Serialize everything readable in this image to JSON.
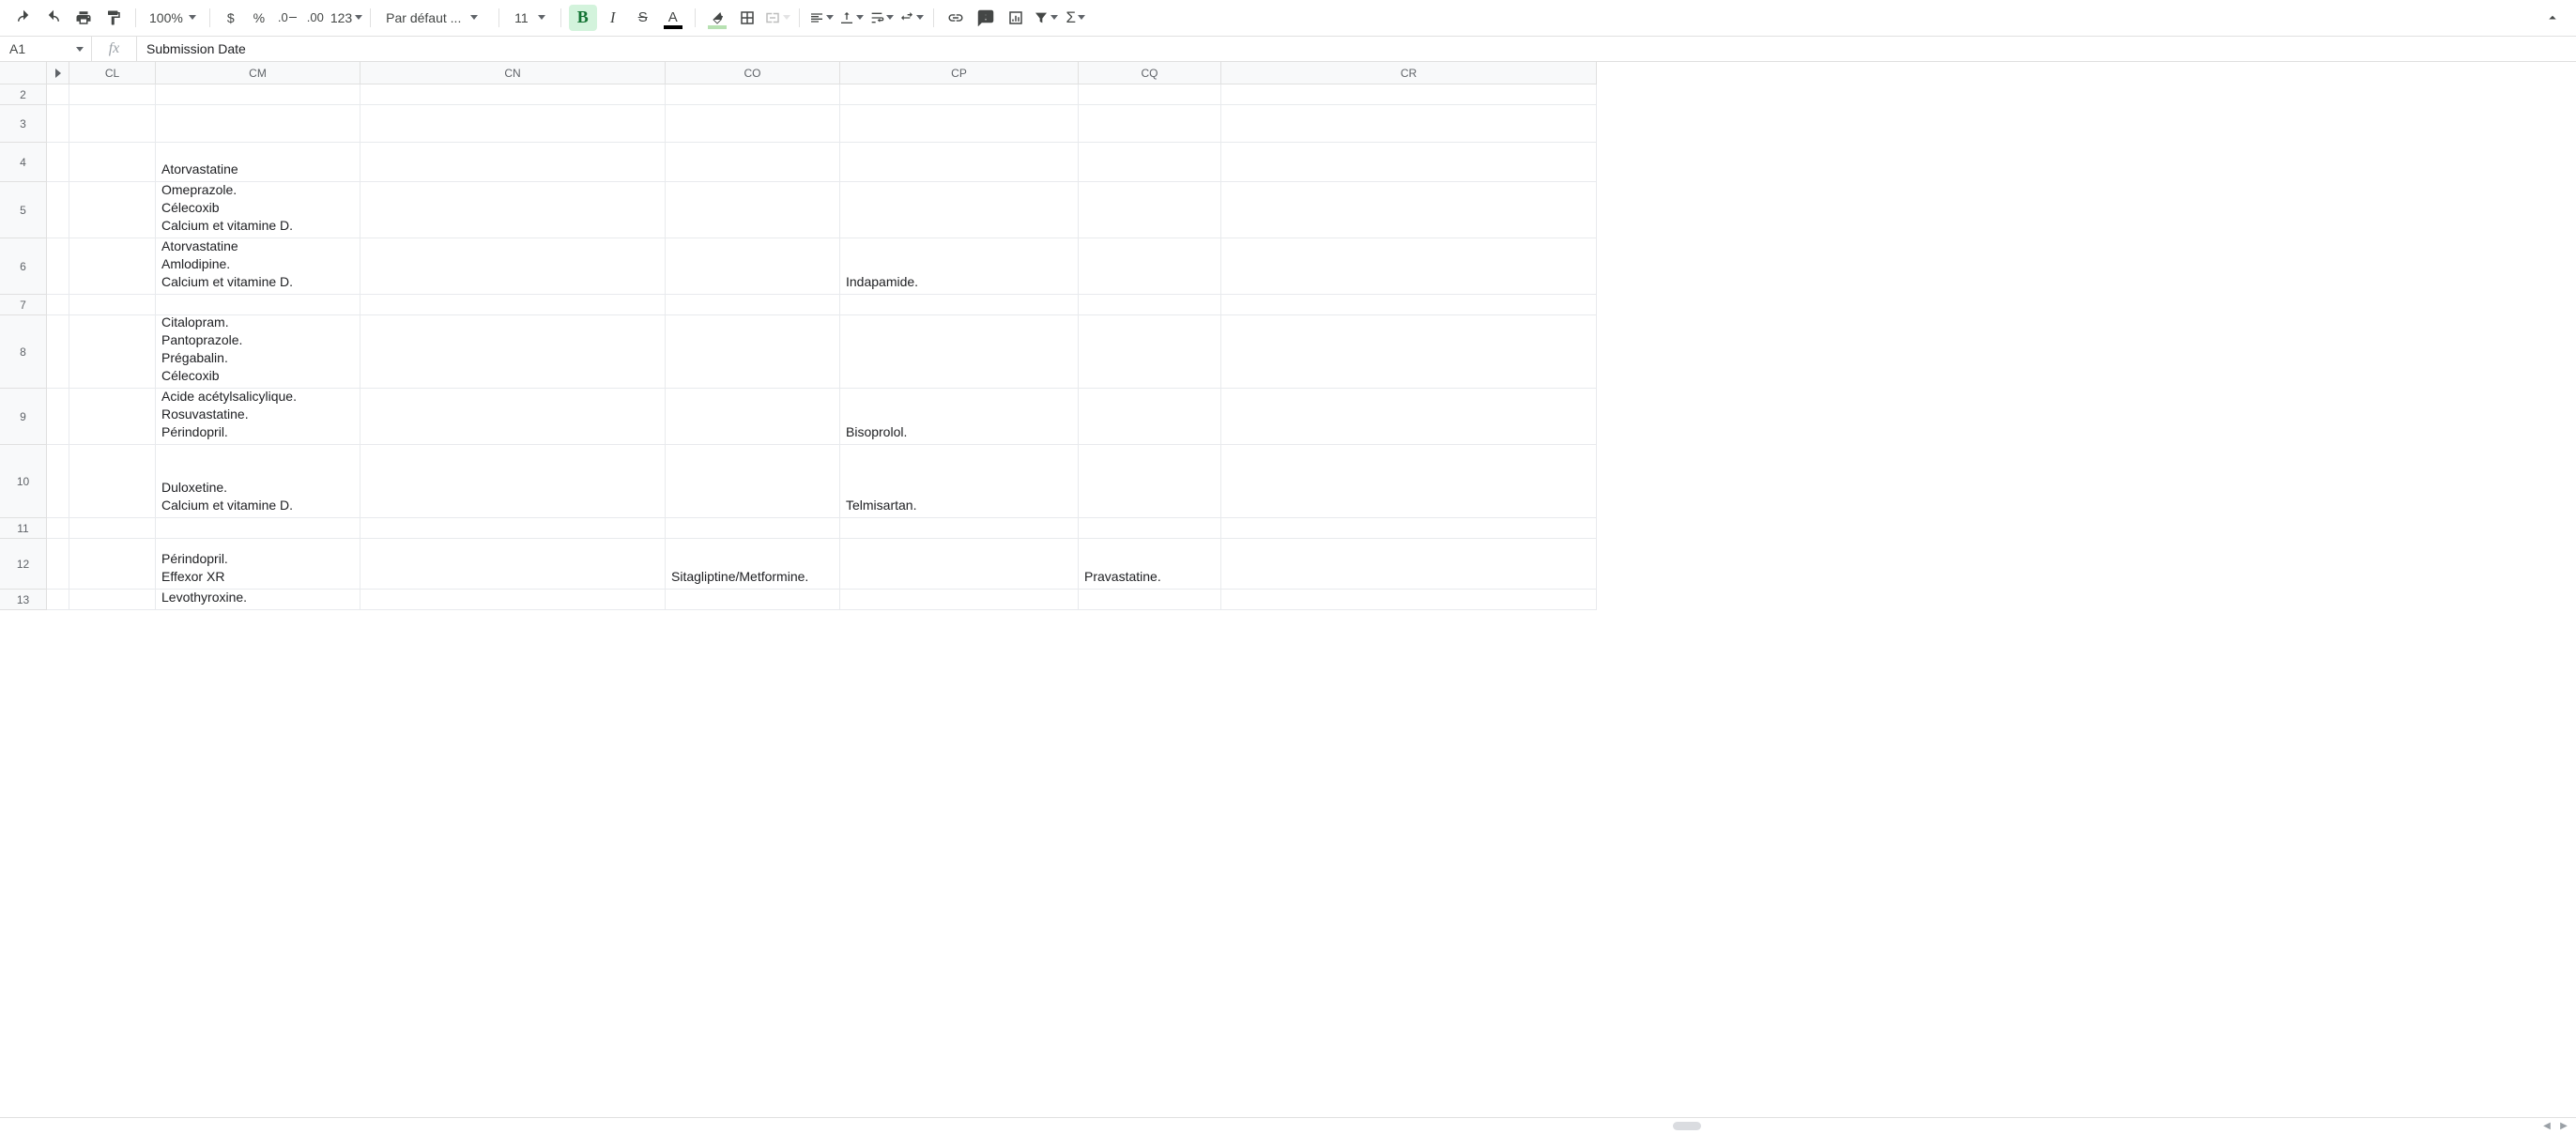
{
  "toolbar": {
    "zoom": "100%",
    "currency_symbol": "$",
    "percent_symbol": "%",
    "decrease_dec": ".0",
    "increase_dec": ".00",
    "more_formats": "123",
    "font_name": "Par défaut ...",
    "font_size": "11",
    "bold": "B",
    "italic": "I",
    "strike": "S",
    "text_color": "A",
    "sigma": "Σ"
  },
  "formula_bar": {
    "cell_ref": "A1",
    "fx": "fx",
    "value": "Submission Date"
  },
  "columns": [
    "CL",
    "CM",
    "CN",
    "CO",
    "CP",
    "CQ",
    "CR"
  ],
  "rows": [
    {
      "n": "2",
      "h": 22,
      "CM": "",
      "CO": "",
      "CP": "",
      "CQ": ""
    },
    {
      "n": "3",
      "h": 40,
      "CM": "",
      "CO": "",
      "CP": "",
      "CQ": ""
    },
    {
      "n": "4",
      "h": 42,
      "CM": "Atorvastatine",
      "CO": "",
      "CP": "",
      "CQ": ""
    },
    {
      "n": "5",
      "h": 60,
      "CM": "Omeprazole.\nCélecoxib\nCalcium et vitamine D.",
      "CO": "",
      "CP": "",
      "CQ": ""
    },
    {
      "n": "6",
      "h": 60,
      "CM": "Atorvastatine\nAmlodipine.\nCalcium et vitamine D.",
      "CO": "",
      "CP": "Indapamide.",
      "CQ": ""
    },
    {
      "n": "7",
      "h": 22,
      "CM": "",
      "CO": "",
      "CP": "",
      "CQ": ""
    },
    {
      "n": "8",
      "h": 78,
      "CM": "Citalopram.\nPantoprazole.\nPrégabalin.\nCélecoxib",
      "CO": "",
      "CP": "",
      "CQ": ""
    },
    {
      "n": "9",
      "h": 60,
      "CM": "Acide acétylsalicylique.\nRosuvastatine.\nPérindopril.",
      "CO": "",
      "CP": "Bisoprolol.",
      "CQ": ""
    },
    {
      "n": "10",
      "h": 78,
      "CM": "Duloxetine.\nCalcium et vitamine D.",
      "CO": "",
      "CP": "Telmisartan.",
      "CQ": ""
    },
    {
      "n": "11",
      "h": 22,
      "CM": "",
      "CO": "",
      "CP": "",
      "CQ": ""
    },
    {
      "n": "12",
      "h": 54,
      "CM": "Périndopril.\nEffexor XR",
      "CO": "Sitagliptine/Metformine.",
      "CP": "",
      "CQ": "Pravastatine."
    },
    {
      "n": "13",
      "h": 22,
      "CM": "Levothyroxine.",
      "CO": "",
      "CP": "",
      "CQ": ""
    }
  ]
}
